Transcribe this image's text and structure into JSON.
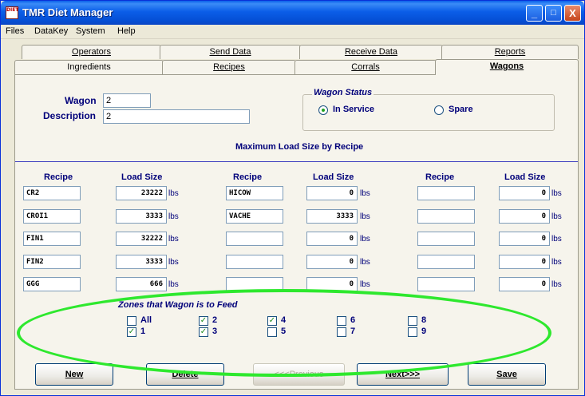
{
  "window": {
    "title": "TMR Diet Manager",
    "controls": {
      "minimize": "_",
      "maximize": "□",
      "close": "X"
    },
    "icon_text": "DIET"
  },
  "menu": [
    "Files",
    "DataKey",
    "System",
    "Help"
  ],
  "tabs_back": [
    "Operators",
    "Send Data",
    "Receive Data",
    "Reports"
  ],
  "tabs_front": [
    "Ingredients",
    "Recipes",
    "Corrals",
    "Wagons"
  ],
  "form": {
    "wagon_label": "Wagon",
    "wagon_value": "2",
    "description_label": "Description",
    "description_value": "2",
    "status_title": "Wagon Status",
    "status_in_service": "In Service",
    "status_spare": "Spare",
    "status_selected": "In Service",
    "max_load_title": "Maximum Load Size by Recipe"
  },
  "columns": {
    "recipe": "Recipe",
    "load": "Load Size",
    "unit": "lbs"
  },
  "recipes": [
    [
      {
        "recipe": "CR2",
        "load": "23222"
      },
      {
        "recipe": "HICOW",
        "load": "0"
      },
      {
        "recipe": "",
        "load": "0"
      }
    ],
    [
      {
        "recipe": "CROI1",
        "load": "3333"
      },
      {
        "recipe": "VACHE",
        "load": "3333"
      },
      {
        "recipe": "",
        "load": "0"
      }
    ],
    [
      {
        "recipe": "FIN1",
        "load": "32222"
      },
      {
        "recipe": "",
        "load": "0"
      },
      {
        "recipe": "",
        "load": "0"
      }
    ],
    [
      {
        "recipe": "FIN2",
        "load": "3333"
      },
      {
        "recipe": "",
        "load": "0"
      },
      {
        "recipe": "",
        "load": "0"
      }
    ],
    [
      {
        "recipe": "GGG",
        "load": "666"
      },
      {
        "recipe": "",
        "load": "0"
      },
      {
        "recipe": "",
        "load": "0"
      }
    ]
  ],
  "zones": {
    "title": "Zones that Wagon is to Feed",
    "items": [
      {
        "label": "All",
        "checked": false
      },
      {
        "label": "1",
        "checked": true
      },
      {
        "label": "2",
        "checked": true
      },
      {
        "label": "3",
        "checked": true
      },
      {
        "label": "4",
        "checked": true
      },
      {
        "label": "5",
        "checked": false
      },
      {
        "label": "6",
        "checked": false
      },
      {
        "label": "7",
        "checked": false
      },
      {
        "label": "8",
        "checked": false
      },
      {
        "label": "9",
        "checked": false
      }
    ]
  },
  "buttons": {
    "new": "New",
    "delete": "Delete",
    "previous": "<<<Previous",
    "next": "Next>>>",
    "save": "Save"
  },
  "colors": {
    "title_bar": "#0a5fe9",
    "label": "#00007a",
    "annotation": "#2ee82e"
  }
}
